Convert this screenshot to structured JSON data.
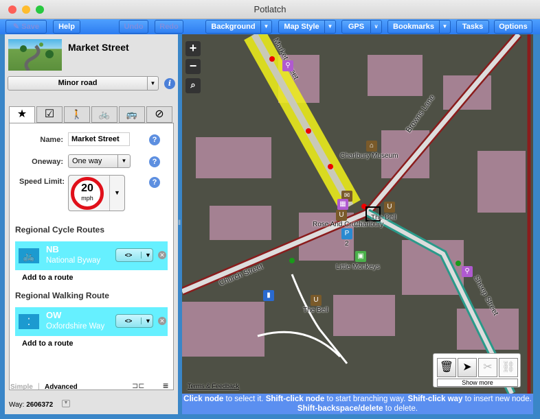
{
  "window": {
    "title": "Potlatch"
  },
  "toolbar": {
    "save": "Save",
    "help": "Help",
    "undo": "Undo",
    "redo": "Redo",
    "background": "Background",
    "map_style": "Map Style",
    "gps": "GPS",
    "bookmarks": "Bookmarks",
    "tasks": "Tasks",
    "options": "Options"
  },
  "panel": {
    "title": "Market Street",
    "road_type": "Minor road",
    "tabs": [
      "★",
      "☑",
      "🚶",
      "🚲",
      "🚌",
      "⊘"
    ],
    "name_label": "Name:",
    "name_value": "Market Street",
    "oneway_label": "Oneway:",
    "oneway_value": "One way",
    "speed_label": "Speed Limit:",
    "speed_value": "20",
    "speed_unit": "mph",
    "cycle_heading": "Regional Cycle Routes",
    "cycle_route": {
      "code": "NB",
      "name": "National Byway",
      "direction": "<>"
    },
    "walk_heading": "Regional Walking Route",
    "walk_route": {
      "code": "OW",
      "name": "Oxfordshire Way",
      "direction": "<>"
    },
    "add_route": "Add to a route",
    "mode_simple": "Simple",
    "mode_advanced": "Advanced",
    "way_label": "Way:",
    "way_id": "2606372"
  },
  "map": {
    "labels": {
      "market": "Market Street",
      "browns": "Browns Lane",
      "museum": "Charlbury Museum",
      "bell1": "The Bell",
      "rose": "Rose And Crown",
      "charlbury": "Charlbury",
      "monkeys": "Little Monkeys",
      "church": "Church Street",
      "sheep": "Sheep Street",
      "bell2": "The Bell",
      "p": "2"
    },
    "terms": "Terms & Feedback",
    "show_more": "Show more"
  },
  "status": {
    "b1": "Click node",
    "t1": " to select it. ",
    "b2": "Shift-click node",
    "t2": " to start branching way. ",
    "b3": "Shift-click way",
    "t3": " to insert new node. ",
    "b4": "Shift-backspace/delete",
    "t4": " to delete."
  },
  "colors": {
    "toolbar": "#2c7cf0",
    "route_bg": "#66f0ff",
    "highlight": "#f2f21a",
    "status_bg": "#5b8ff0"
  }
}
